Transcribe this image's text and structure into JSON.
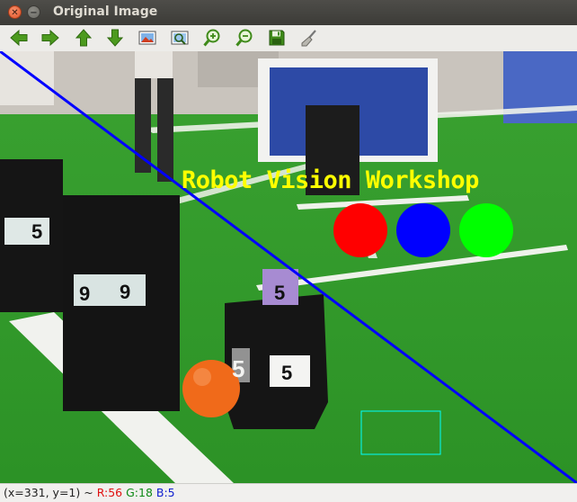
{
  "window": {
    "title": "Original Image",
    "close_glyph": "✕",
    "minimize_glyph": "−"
  },
  "toolbar": {
    "items": [
      {
        "name": "pan-left",
        "icon": "arrow-left-icon"
      },
      {
        "name": "pan-right",
        "icon": "arrow-right-icon"
      },
      {
        "name": "pan-up",
        "icon": "arrow-up-icon"
      },
      {
        "name": "pan-down",
        "icon": "arrow-down-icon"
      },
      {
        "name": "zoom-original",
        "icon": "image-icon"
      },
      {
        "name": "zoom-fit",
        "icon": "zoom-fit-icon"
      },
      {
        "name": "zoom-in",
        "icon": "zoom-in-icon"
      },
      {
        "name": "zoom-out",
        "icon": "zoom-out-icon"
      },
      {
        "name": "save",
        "icon": "save-icon"
      },
      {
        "name": "properties",
        "icon": "brush-icon"
      }
    ]
  },
  "image": {
    "overlay_text": "Robot Vision Workshop",
    "text_color": "#ffff00",
    "circle_colors": [
      "#ff0000",
      "#0000ff",
      "#00ff00"
    ],
    "line_color": "#0000ff",
    "rect_color": "#00ffff",
    "field_color": "#2f9a2a",
    "robot_numbers": [
      "5",
      "9",
      "9",
      "5",
      "5",
      "5"
    ]
  },
  "status": {
    "coords": "(x=331, y=1) ~",
    "r": "R:56",
    "g": "G:18",
    "b": "B:5"
  }
}
